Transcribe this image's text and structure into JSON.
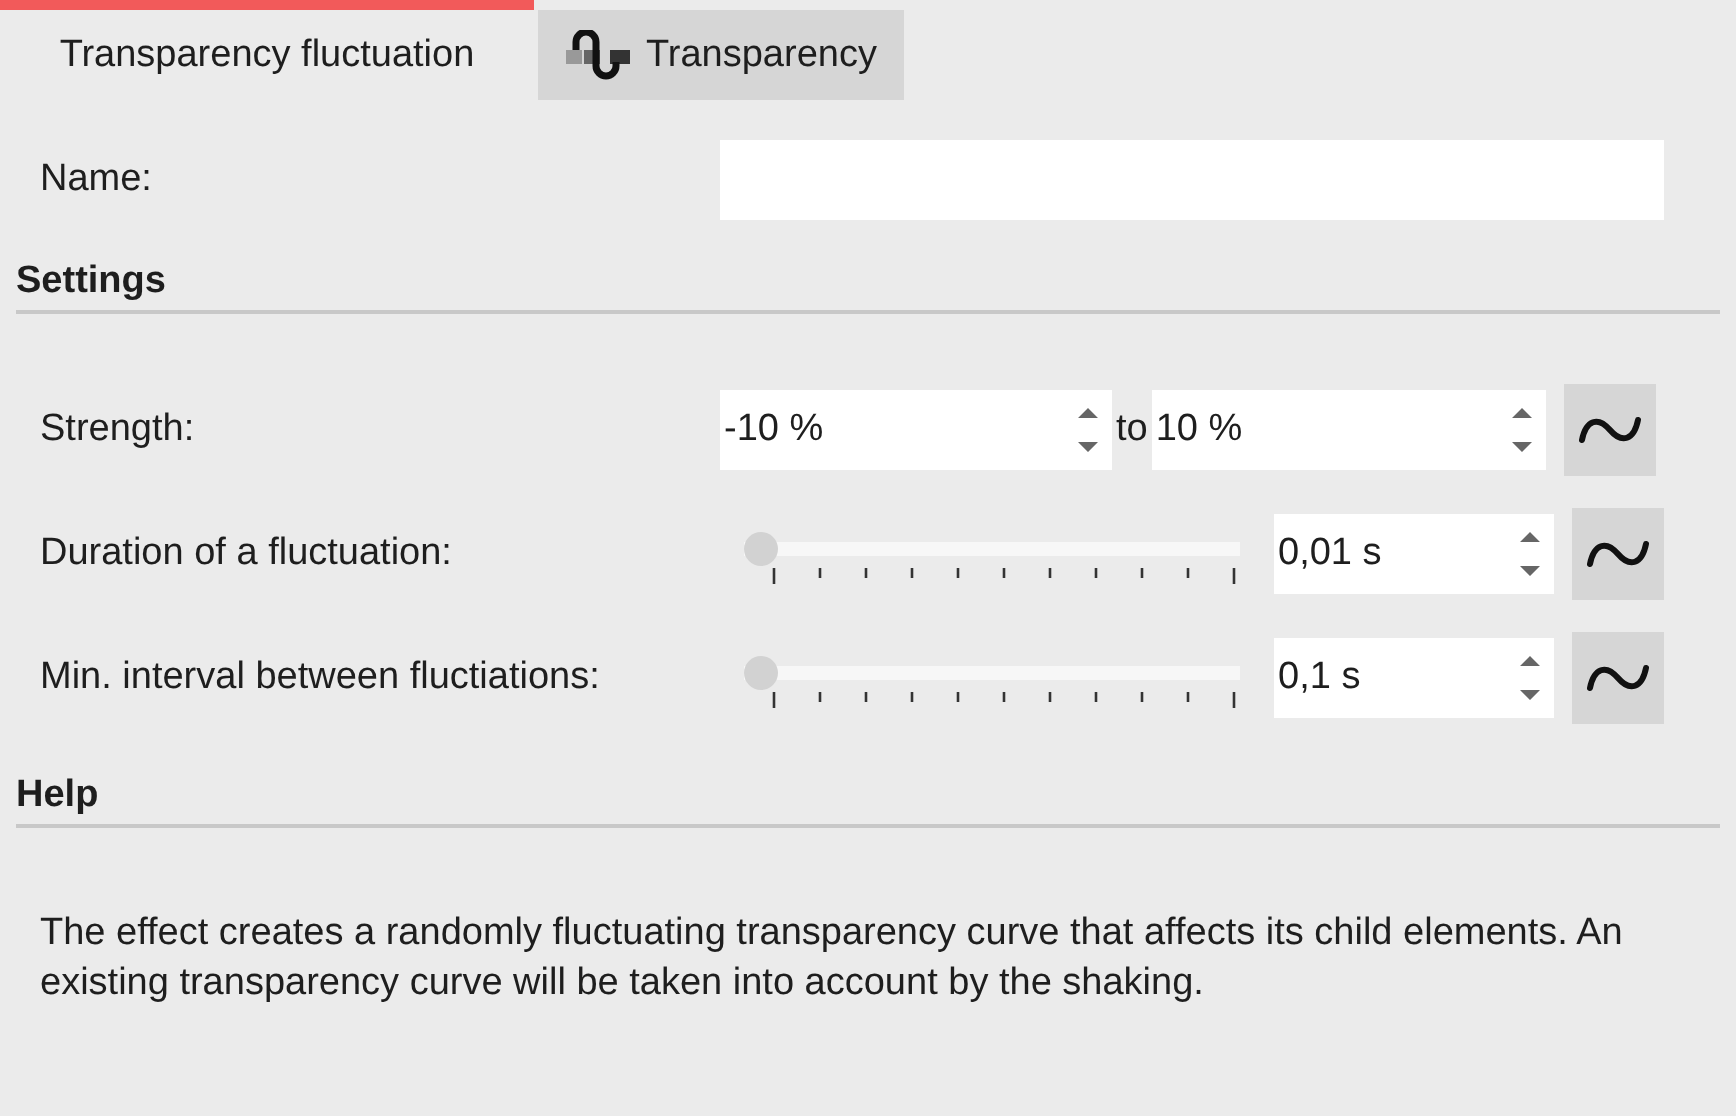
{
  "tabs": [
    {
      "label": "Transparency fluctuation",
      "selected": true,
      "kind": "plain"
    },
    {
      "label": "Transparency",
      "selected": false,
      "kind": "with-icon"
    }
  ],
  "name_field": {
    "label": "Name:"
  },
  "settings": {
    "title": "Settings",
    "rows": [
      {
        "kind": "range",
        "label": "Strength:",
        "from": "-10 %",
        "joiner": "to",
        "to": "10 %"
      },
      {
        "kind": "slider",
        "label": "Duration of a fluctuation:",
        "level": 0,
        "value": "0,01 s"
      },
      {
        "kind": "slider",
        "label": "Min. interval between fluctiations:",
        "level": 0,
        "value": "0,1 s"
      }
    ]
  },
  "help": {
    "title": "Help",
    "text": "The effect creates a randomly fluctuating transparency curve that affects its child elements. An existing transparency curve will be taken into account by the shaking."
  }
}
